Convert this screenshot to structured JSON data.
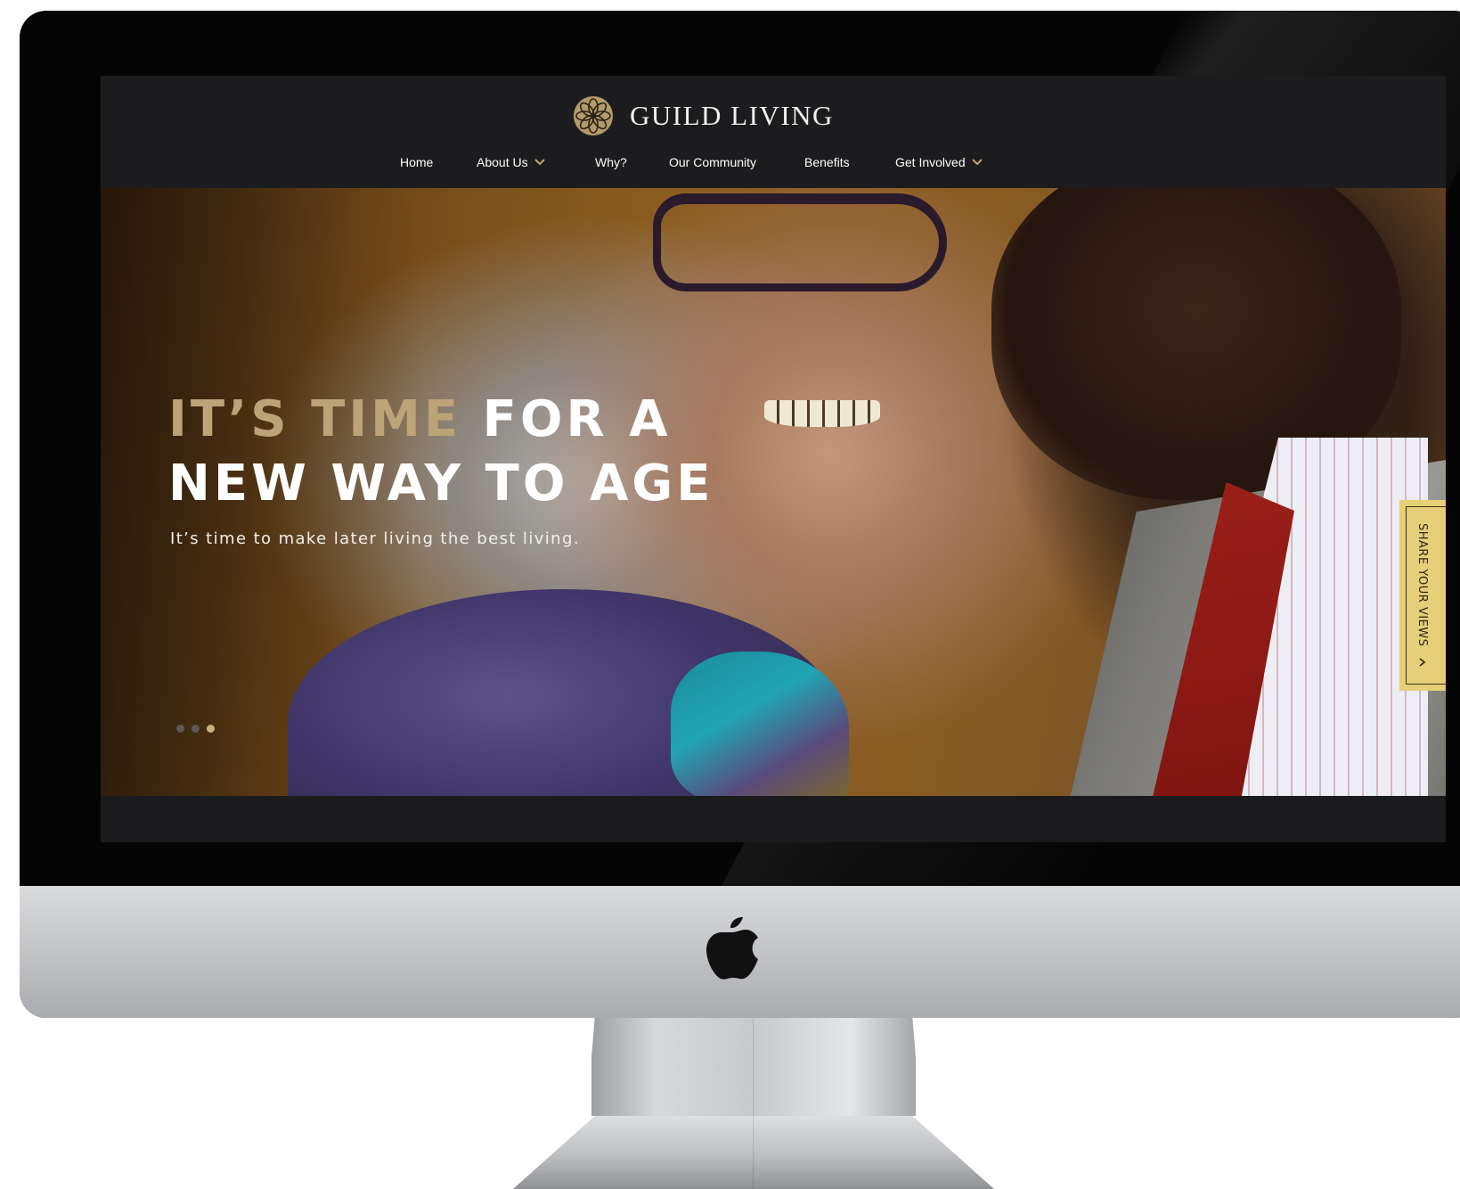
{
  "brand": {
    "name": "GUILD LIVING",
    "accent_color": "#bda378",
    "logo_icon": "flower-rosette-icon"
  },
  "nav": {
    "items": [
      {
        "label": "Home",
        "has_dropdown": false
      },
      {
        "label": "About Us",
        "has_dropdown": true
      },
      {
        "label": "Why?",
        "has_dropdown": false
      },
      {
        "label": "Our Community",
        "has_dropdown": false
      },
      {
        "label": "Benefits",
        "has_dropdown": false
      },
      {
        "label": "Get Involved",
        "has_dropdown": true
      }
    ]
  },
  "hero": {
    "title_line1_gold": "IT’S TIME",
    "title_line1_white": "FOR A",
    "title_line2": "NEW WAY TO AGE",
    "subtitle": "It’s time to make later living the best living.",
    "slides_total": 3,
    "active_slide": 3
  },
  "share_tab": {
    "label": "SHARE YOUR VIEWS",
    "background": "#e7ce78"
  },
  "device": {
    "logo_icon": "apple-logo-icon"
  }
}
